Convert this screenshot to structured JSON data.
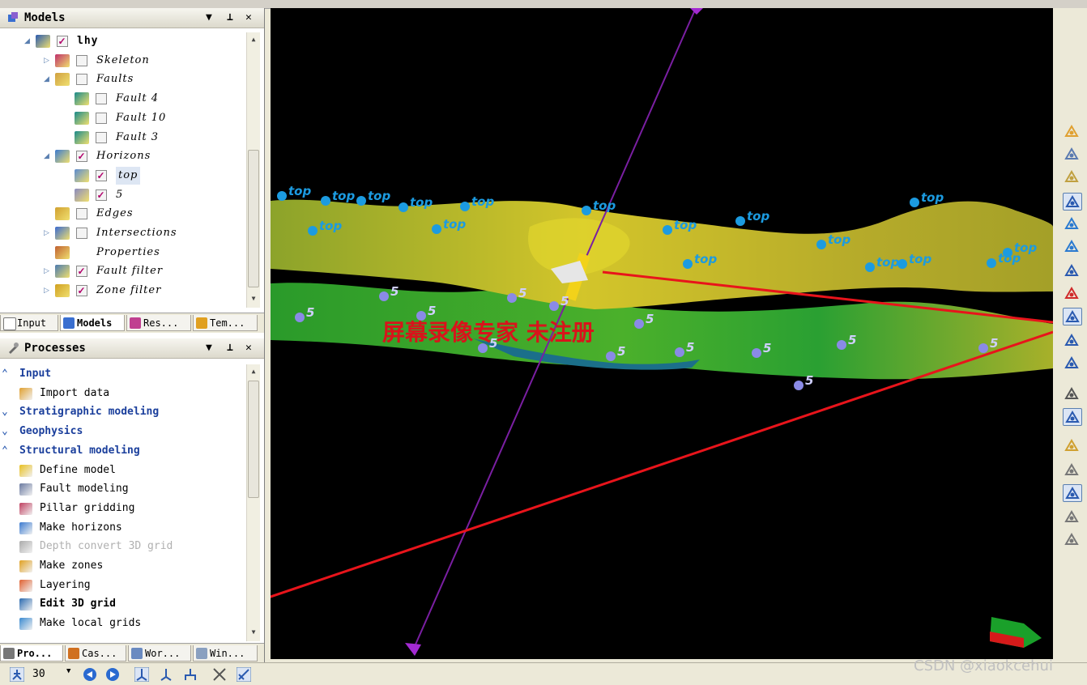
{
  "models_panel": {
    "title": "Models",
    "controls": [
      "▼",
      "⊥",
      "✕"
    ],
    "tree": [
      {
        "label": "lhy",
        "checked": true,
        "icon": "cube-icon"
      },
      {
        "label": "Skeleton",
        "checked": false,
        "icon": "grid-icon"
      },
      {
        "label": "Faults",
        "checked": false,
        "icon": "faults-folder-icon"
      },
      {
        "label": "Fault 4",
        "checked": false,
        "icon": "fault-icon"
      },
      {
        "label": "Fault 10",
        "checked": false,
        "icon": "fault-icon"
      },
      {
        "label": "Fault 3",
        "checked": false,
        "icon": "fault-icon"
      },
      {
        "label": "Horizons",
        "checked": true,
        "icon": "horizons-folder-icon"
      },
      {
        "label": "top",
        "checked": true,
        "icon": "horizon-icon"
      },
      {
        "label": "5",
        "checked": true,
        "icon": "horizon-icon"
      },
      {
        "label": "Edges",
        "checked": false,
        "icon": "edges-icon"
      },
      {
        "label": "Intersections",
        "checked": false,
        "icon": "intersections-icon"
      },
      {
        "label": "Properties",
        "checked": null,
        "icon": "properties-icon"
      },
      {
        "label": "Fault filter",
        "checked": true,
        "icon": "fault-filter-icon"
      },
      {
        "label": "Zone filter",
        "checked": true,
        "icon": "zone-filter-icon"
      }
    ],
    "tabs": [
      "Input",
      "Models",
      "Res...",
      "Tem..."
    ]
  },
  "processes_panel": {
    "title": "Processes",
    "controls": [
      "▼",
      "⊥",
      "✕"
    ],
    "items": [
      {
        "label": "Input",
        "type": "category"
      },
      {
        "label": "Import data",
        "type": "item"
      },
      {
        "label": "Stratigraphic modeling",
        "type": "category"
      },
      {
        "label": "Geophysics",
        "type": "category"
      },
      {
        "label": "Structural modeling",
        "type": "category"
      },
      {
        "label": "Define model",
        "type": "item"
      },
      {
        "label": "Fault modeling",
        "type": "item"
      },
      {
        "label": "Pillar gridding",
        "type": "item"
      },
      {
        "label": "Make horizons",
        "type": "item"
      },
      {
        "label": "Depth convert 3D grid",
        "type": "disabled"
      },
      {
        "label": "Make zones",
        "type": "item"
      },
      {
        "label": "Layering",
        "type": "item"
      },
      {
        "label": "Edit 3D grid",
        "type": "bold"
      },
      {
        "label": "Make local grids",
        "type": "item"
      }
    ],
    "tabs": [
      "Pro...",
      "Cas...",
      "Wor...",
      "Win..."
    ]
  },
  "viewport": {
    "overlay_text": "屏幕录像专家 未注册",
    "labels_top": "top",
    "labels_5": "5"
  },
  "bottom_toolbar": {
    "value": "30"
  },
  "watermark": "CSDN @xiaokcehui",
  "colors": {
    "accent": "#1b3f9c",
    "annotation": "#e8141b",
    "well": "#7a1fa2",
    "marker": "#1c9be0"
  }
}
